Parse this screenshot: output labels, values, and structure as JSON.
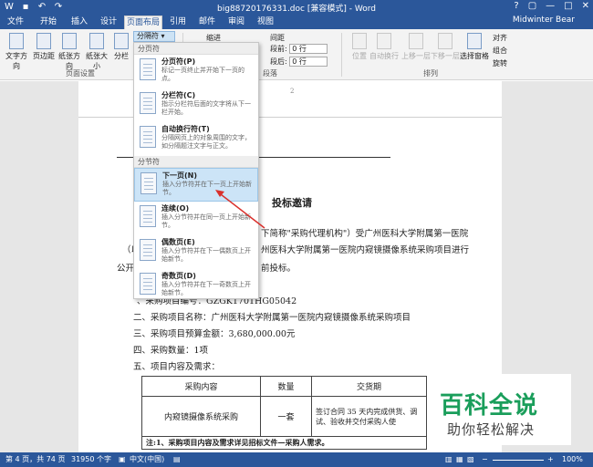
{
  "window": {
    "title": "big88720176331.doc [兼容模式] - Word",
    "user": "Midwinter Bear",
    "controls": [
      "?",
      "▢",
      "—",
      "□",
      "✕"
    ]
  },
  "tabs": [
    "文件",
    "开始",
    "插入",
    "设计",
    "页面布局",
    "引用",
    "邮件",
    "审阅",
    "视图"
  ],
  "ribbon": {
    "buttons": [
      "文字方向",
      "页边距",
      "纸张方向",
      "纸张大小",
      "分栏"
    ],
    "breaks_button": "分隔符",
    "indent_label": "缩进",
    "spacing_label": "间距",
    "spacing_before_label": "段前:",
    "spacing_before_value": "0 行",
    "spacing_after_label": "段后:",
    "spacing_after_value": "0 行",
    "arrange_buttons": [
      "位置",
      "自动换行",
      "上移一层",
      "下移一层",
      "选择窗格"
    ],
    "align_items": [
      "对齐",
      "组合",
      "旋转"
    ],
    "group_page_setup": "页面设置",
    "group_paragraph": "段落",
    "group_arrange": "排列"
  },
  "dropdown": {
    "section1": "分页符",
    "section2": "分节符",
    "items": [
      {
        "title": "分页符(P)",
        "desc": "标记一页终止并开始下一页的点。"
      },
      {
        "title": "分栏符(C)",
        "desc": "指示分栏符后面的文字将从下一栏开始。"
      },
      {
        "title": "自动换行符(T)",
        "desc": "分隔网页上的对象周围的文字，如分隔题注文字与正文。"
      },
      {
        "title": "下一页(N)",
        "desc": "插入分节符并在下一页上开始新节。"
      },
      {
        "title": "连续(O)",
        "desc": "插入分节符并在同一页上开始新节。"
      },
      {
        "title": "偶数页(E)",
        "desc": "插入分节符并在下一偶数页上开始新节。"
      },
      {
        "title": "奇数页(D)",
        "desc": "插入分节符并在下一奇数页上开始新节。"
      }
    ]
  },
  "document": {
    "ruler_mark": "2",
    "heading": "投标邀请",
    "line1": "下简称\"采购代理机构\"）受广州医科大学附属第一医院",
    "line2_prefix": "（以",
    "line2": "州医科大学附属第一医院内窥镜摄像系统采购项目进行",
    "line3_prefix": "公开",
    "line3": "前投标。",
    "item1": "、采购项目编号：GZGK1701HG05042",
    "item2": "二、采购项目名称：广州医科大学附属第一医院内窥镜摄像系统采购项目",
    "item3": "三、采购项目预算金额：3,680,000.00元",
    "item4": "四、采购数量：1项",
    "item5": "五、项目内容及需求：",
    "table_headers": [
      "采购内容",
      "数量",
      "交货期"
    ],
    "table_row": [
      "内窥镜摄像系统采购",
      "一套",
      "签订合同 35 天内完成供货、调试、验收并交付采购人使"
    ],
    "note": "注:1、采购项目内容及需求详见招标文件—采购人需求。"
  },
  "watermark": {
    "big": "百科全说",
    "small": "助你轻松解决"
  },
  "status": {
    "page": "第 4 页，共 74 页",
    "words": "31950 个字",
    "language": "中文(中国)",
    "zoom": "100%"
  }
}
